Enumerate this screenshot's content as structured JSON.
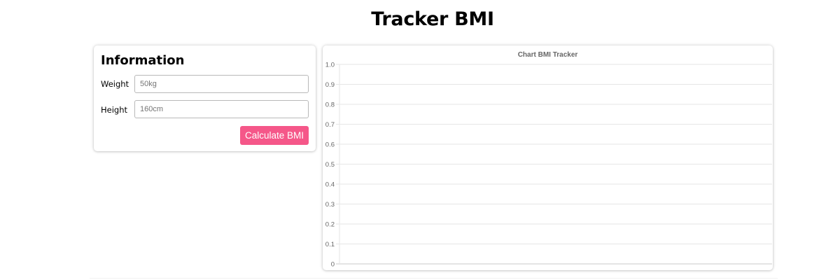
{
  "page": {
    "title": "Tracker BMI"
  },
  "form": {
    "title": "Information",
    "weight_label": "Weight",
    "weight_placeholder": "50kg",
    "weight_value": "",
    "height_label": "Height",
    "height_placeholder": "160cm",
    "height_value": "",
    "submit_label": "Calculate BMI",
    "submit_color": "#f55789"
  },
  "chart_data": {
    "type": "line",
    "title": "Chart BMI Tracker",
    "xlabel": "",
    "ylabel": "",
    "x": [],
    "series": [],
    "ylim": [
      0,
      1
    ],
    "yticks": [
      "1.0",
      "0.9",
      "0.8",
      "0.7",
      "0.6",
      "0.5",
      "0.4",
      "0.3",
      "0.2",
      "0.1",
      "0"
    ],
    "grid": true
  }
}
